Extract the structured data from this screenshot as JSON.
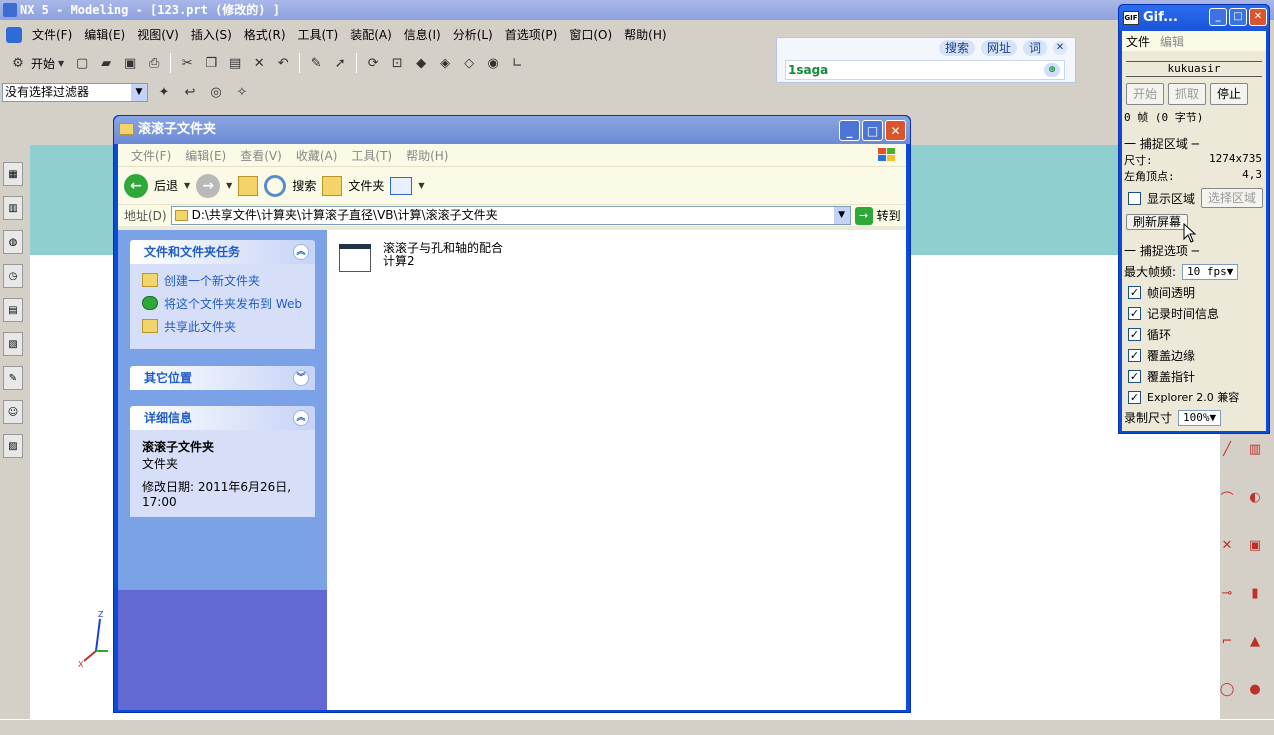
{
  "nx": {
    "title": "NX 5 - Modeling - [123.prt  (修改的) ]",
    "menus": [
      "文件(F)",
      "编辑(E)",
      "视图(V)",
      "插入(S)",
      "格式(R)",
      "工具(T)",
      "装配(A)",
      "信息(I)",
      "分析(L)",
      "首选项(P)",
      "窗口(O)",
      "帮助(H)"
    ],
    "start_label": "开始",
    "filter_value": "没有选择过滤器",
    "axis_z": "Z",
    "axis_x": "X",
    "axis_y": "Y"
  },
  "search_widget": {
    "tab_search": "搜索",
    "tab_web": "网址",
    "tab_dict": "词",
    "query": "1saga"
  },
  "explorer": {
    "title": "滚滚子文件夹",
    "menus": [
      "文件(F)",
      "编辑(E)",
      "查看(V)",
      "收藏(A)",
      "工具(T)",
      "帮助(H)"
    ],
    "back_label": "后退",
    "search_label": "搜索",
    "folders_label": "文件夹",
    "address_label": "地址(D)",
    "address_value": "D:\\共享文件\\计算夹\\计算滚子直径\\VB\\计算\\滚滚子文件夹",
    "go_label": "转到",
    "tasks_title": "文件和文件夹任务",
    "tasks": [
      "创建一个新文件夹",
      "将这个文件夹发布到 Web",
      "共享此文件夹"
    ],
    "other_title": "其它位置",
    "details_title": "详细信息",
    "details_name": "滚滚子文件夹",
    "details_type": "文件夹",
    "details_modified": "修改日期: 2011年6月26日, 17:00",
    "file_name": "滚滚子与孔和轴的配合计算2"
  },
  "gifrec": {
    "title": "Gif...",
    "menu_file": "文件",
    "menu_edit": "编辑",
    "user": "kukuasir",
    "btn_start": "开始",
    "btn_capture": "抓取",
    "btn_stop": "停止",
    "frames": "0 帧 (0 字节)",
    "capture_area_title": "一 捕捉区域 ─",
    "size_label": "尺寸:",
    "size_value": "1274x735",
    "corner_label": "左角顶点:",
    "corner_value": "4,3",
    "show_area_label": "显示区域",
    "select_area_label": "选择区域",
    "refresh_label": "刷新屏幕",
    "options_title": "一 捕捉选项 ─",
    "max_fps_label": "最大帧频:",
    "max_fps_value": "10 fps",
    "options": [
      "帧间透明",
      "记录时间信息",
      "循环",
      "覆盖边缘",
      "覆盖指针",
      "Explorer 2.0 兼容"
    ],
    "rec_size_label": "录制尺寸",
    "rec_size_value": "100%"
  }
}
